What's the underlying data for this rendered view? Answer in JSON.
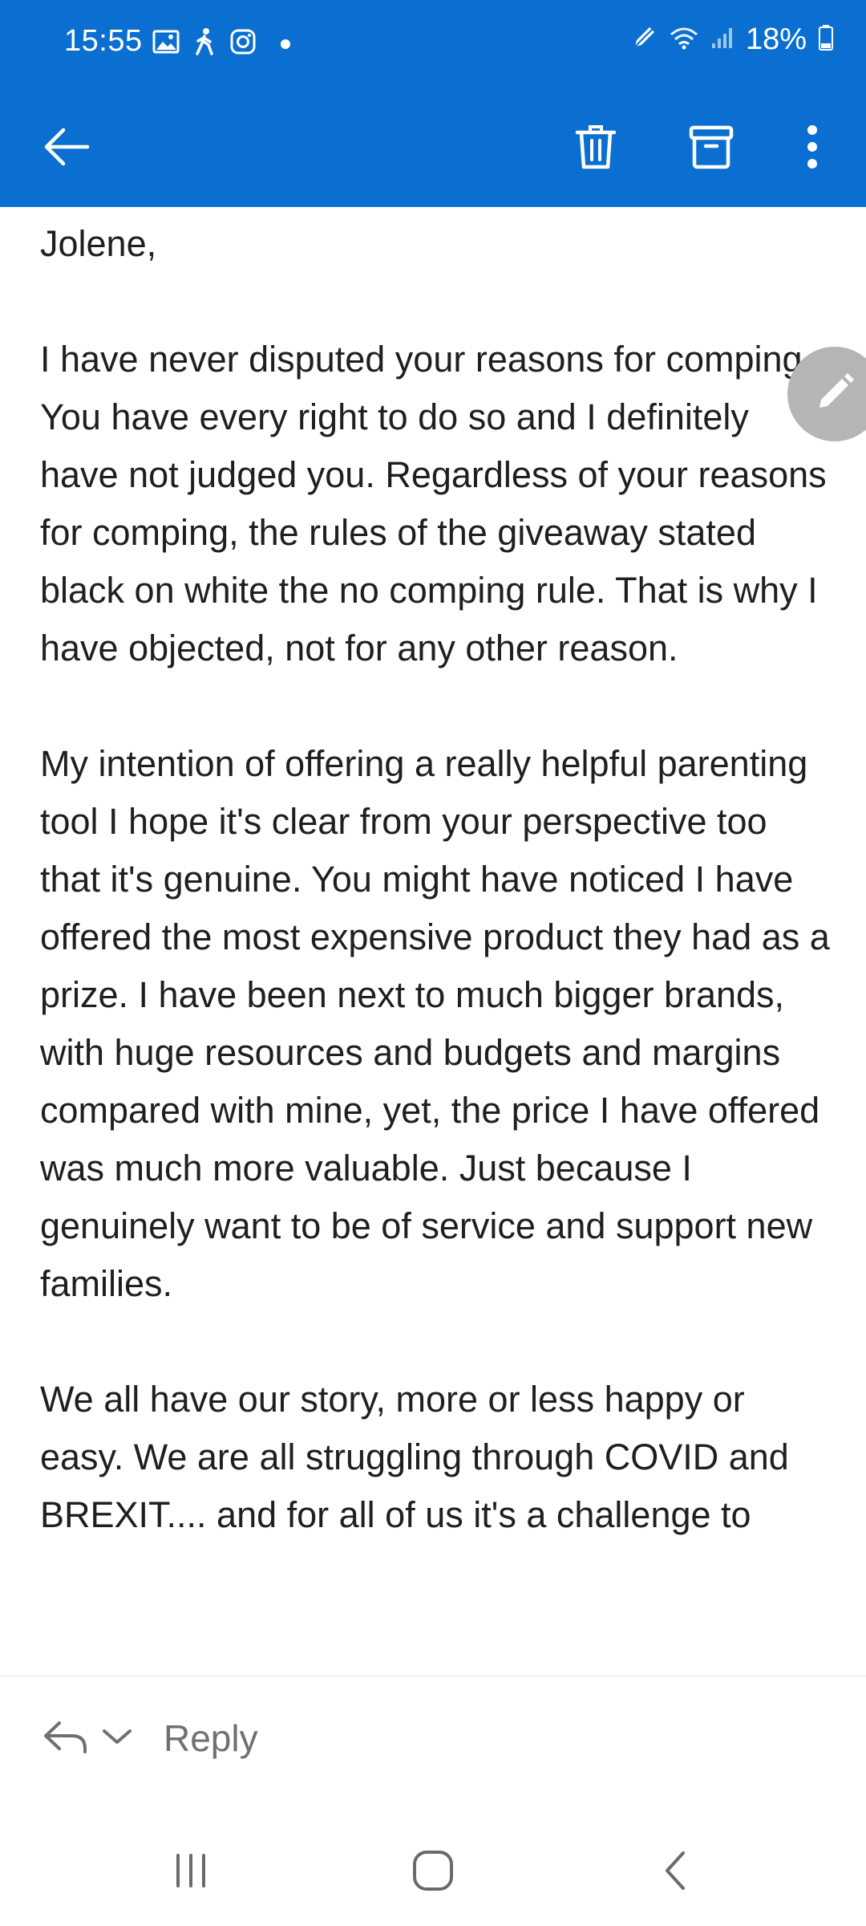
{
  "status_bar": {
    "time": "15:55",
    "battery": "18%",
    "left_icons": [
      "gallery-icon",
      "walking-icon",
      "instagram-icon",
      "dot-icon"
    ],
    "right_icons": [
      "pen-icon",
      "wifi-icon",
      "signal-icon",
      "battery-icon"
    ]
  },
  "toolbar": {
    "back_icon": "back-arrow-icon",
    "actions": [
      "trash-icon",
      "archive-icon",
      "more-vertical-icon"
    ]
  },
  "message": {
    "greeting": "Jolene,",
    "paragraphs": [
      "I have never disputed your reasons for comping. You have every right to do so and I definitely have not judged you. Regardless of your reasons for comping, the rules of the giveaway stated black on white the no comping rule. That is why I have objected, not for any other reason.",
      "My intention of offering a really helpful parenting tool I hope it's clear from your perspective too that it's genuine. You might have noticed I have offered the most expensive product they had as a prize. I have been next to much bigger brands, with huge resources and budgets and margins compared with mine, yet, the price I have offered was much more valuable. Just because I genuinely want to be of service and support new families.",
      "We all have our story, more or less happy or easy. We are all struggling through COVID and BREXIT.... and for all of us it's a challenge to"
    ]
  },
  "fab": {
    "icon": "pencil-icon"
  },
  "reply_bar": {
    "label": "Reply"
  },
  "colors": {
    "accent": "#0a6fd1",
    "fab": "#b5b5b5"
  }
}
